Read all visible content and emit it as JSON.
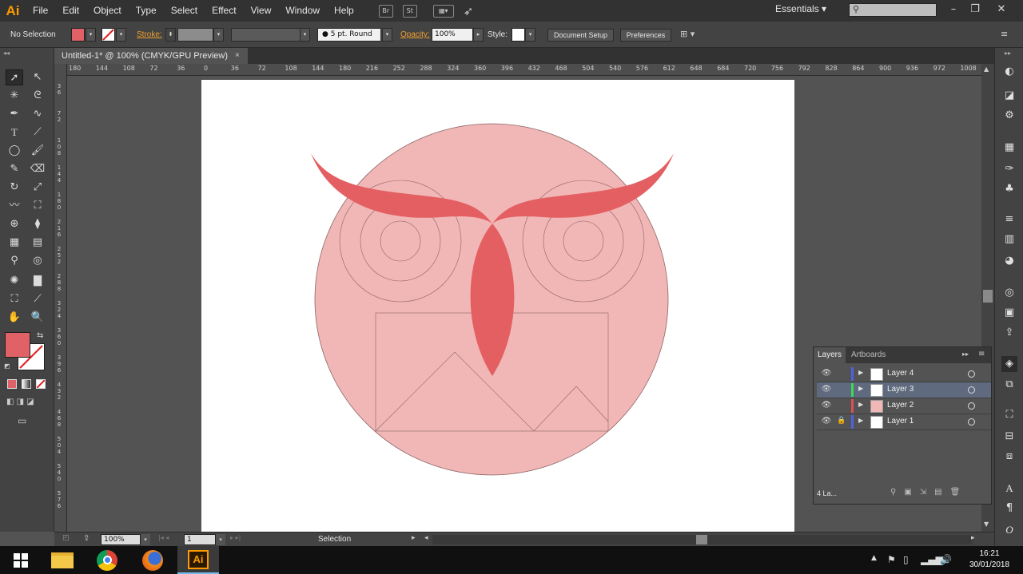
{
  "app": {
    "logo": "Ai"
  },
  "menu": [
    "File",
    "Edit",
    "Object",
    "Type",
    "Select",
    "Effect",
    "View",
    "Window",
    "Help"
  ],
  "menu_icons": {
    "bridge": "Br",
    "stock": "St"
  },
  "workspace": {
    "label": "Essentials",
    "search_placeholder": ""
  },
  "control": {
    "selection_label": "No Selection",
    "fill_color": "#e06266",
    "stroke_label": "Stroke:",
    "brush_label": "5 pt. Round",
    "opacity_label": "Opacity:",
    "opacity_value": "100%",
    "style_label": "Style:",
    "document_setup": "Document Setup",
    "preferences": "Preferences"
  },
  "document": {
    "tab_title": "Untitled-1* @ 100% (CMYK/GPU Preview)",
    "close": "×"
  },
  "hruler_ticks": [
    "180",
    "144",
    "108",
    "72",
    "36",
    "0",
    "36",
    "72",
    "108",
    "144",
    "180",
    "216",
    "252",
    "288",
    "324",
    "360",
    "396",
    "432",
    "468",
    "504",
    "540",
    "576",
    "612",
    "648",
    "684",
    "720",
    "756",
    "792",
    "828",
    "864",
    "900",
    "936",
    "972",
    "1008"
  ],
  "vruler_ticks": [
    "3\n6",
    "7\n2",
    "1\n0\n8",
    "1\n4\n4",
    "1\n8\n0",
    "2\n1\n6",
    "2\n5\n2",
    "2\n8\n8",
    "3\n2\n4",
    "3\n6\n0",
    "3\n9\n6",
    "4\n3\n2",
    "4\n6\n8",
    "5\n0\n4",
    "5\n4\n0",
    "5\n7\n6"
  ],
  "status": {
    "zoom": "100%",
    "page": "1",
    "tool": "Selection"
  },
  "layers_panel": {
    "tab_layers": "Layers",
    "tab_artboards": "Artboards",
    "count": "4 La...",
    "layers": [
      {
        "name": "Layer 4",
        "color": "#4a64e0",
        "locked": false,
        "selected": false
      },
      {
        "name": "Layer 3",
        "color": "#3cd85a",
        "locked": false,
        "selected": true
      },
      {
        "name": "Layer 2",
        "color": "#e05050",
        "locked": false,
        "selected": false
      },
      {
        "name": "Layer 1",
        "color": "#4a64e0",
        "locked": true,
        "selected": false
      }
    ]
  },
  "artwork": {
    "head_color": "#f1b7b6",
    "feature_color": "#e35f62",
    "outline_color": "#8c6464"
  },
  "taskbar": {
    "time": "16:21",
    "date": "30/01/2018"
  }
}
